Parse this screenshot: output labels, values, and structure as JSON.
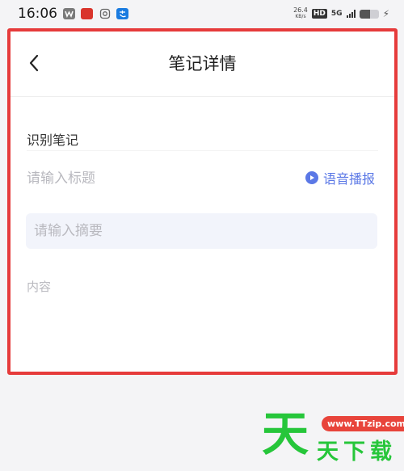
{
  "status_bar": {
    "time": "16:06",
    "net_speed_value": "26.4",
    "net_speed_unit": "KB/s",
    "hd": "HD",
    "signal": "5G",
    "battery_level": 0.55
  },
  "header": {
    "title": "笔记详情",
    "back_icon": "chevron-left-icon"
  },
  "form": {
    "section_label": "识别笔记",
    "title_placeholder": "请输入标题",
    "voice_button_label": "语音播报",
    "voice_icon": "play-circle-icon",
    "summary_placeholder": "请输入摘要",
    "content_placeholder": "内容"
  },
  "watermark": {
    "url": "www.TTzip.com",
    "big_char": "天",
    "small_text": "天下载"
  },
  "colors": {
    "highlight_border": "#e63b3b",
    "accent": "#5b78e6",
    "watermark_green": "#26c63a"
  }
}
